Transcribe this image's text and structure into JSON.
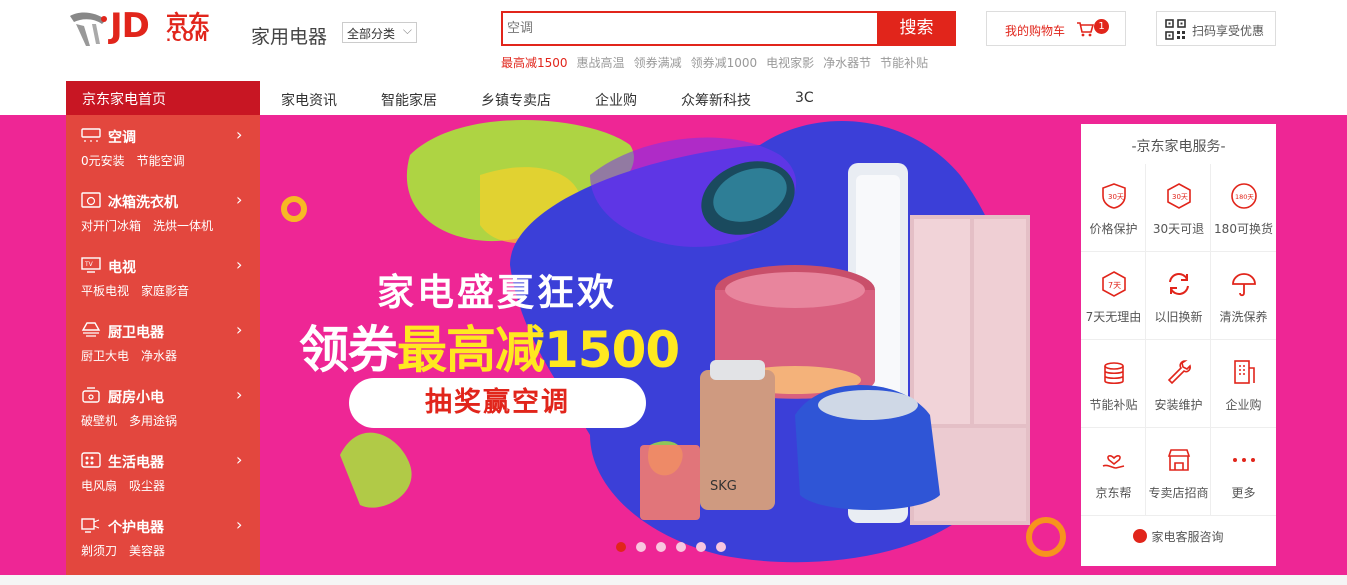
{
  "header": {
    "logo": {
      "text": "JD",
      "cn": "京东",
      "com": ".COM"
    },
    "site_title": "家用电器",
    "all_categories": "全部分类",
    "search": {
      "placeholder": "空调",
      "button": "搜索"
    },
    "hotwords": [
      "最高减1500",
      "惠战高温",
      "领券满减",
      "领券减1000",
      "电视家影",
      "净水器节",
      "节能补贴"
    ],
    "cart": {
      "label": "我的购物车",
      "count": "1"
    },
    "qr": {
      "label": "扫码享受优惠"
    }
  },
  "nav": {
    "home": "京东家电首页",
    "items": [
      "家电资讯",
      "智能家居",
      "乡镇专卖店",
      "企业购",
      "众筹新科技",
      "3C"
    ]
  },
  "sidebar": {
    "categories": [
      {
        "title": "空调",
        "subs": [
          "0元安装",
          "节能空调"
        ],
        "icon": "air-conditioner-icon"
      },
      {
        "title": "冰箱洗衣机",
        "subs": [
          "对开门冰箱",
          "洗烘一体机"
        ],
        "icon": "washer-icon"
      },
      {
        "title": "电视",
        "subs": [
          "平板电视",
          "家庭影音"
        ],
        "icon": "tv-icon"
      },
      {
        "title": "厨卫电器",
        "subs": [
          "厨卫大电",
          "净水器"
        ],
        "icon": "range-hood-icon"
      },
      {
        "title": "厨房小电",
        "subs": [
          "破壁机",
          "多用途锅"
        ],
        "icon": "cooker-icon"
      },
      {
        "title": "生活电器",
        "subs": [
          "电风扇",
          "吸尘器"
        ],
        "icon": "appliance-icon"
      },
      {
        "title": "个护电器",
        "subs": [
          "剃须刀",
          "美容器"
        ],
        "icon": "shaver-icon"
      }
    ]
  },
  "banner": {
    "headline1": "家电盛夏狂欢",
    "headline2_white": "领券",
    "headline2_yellow": "最高减1500",
    "cta": "抽奖赢空调",
    "slide_count": 6,
    "active_slide": 1,
    "colors": {
      "background": "#ee2695",
      "accent": "#ffe820",
      "brand": "#e1251b"
    }
  },
  "service": {
    "title": "-京东家电服务-",
    "items": [
      {
        "label": "价格保护",
        "icon": "30-days-shield-icon",
        "badge": "30天"
      },
      {
        "label": "30天可退",
        "icon": "30-days-return-icon",
        "badge": "30天"
      },
      {
        "label": "180可换货",
        "icon": "180-days-exchange-icon",
        "badge": "180天"
      },
      {
        "label": "7天无理由",
        "icon": "7-days-icon",
        "badge": "7天"
      },
      {
        "label": "以旧换新",
        "icon": "refresh-icon",
        "badge": ""
      },
      {
        "label": "清洗保养",
        "icon": "umbrella-icon",
        "badge": ""
      },
      {
        "label": "节能补贴",
        "icon": "coin-stack-icon",
        "badge": ""
      },
      {
        "label": "安装维护",
        "icon": "wrench-icon",
        "badge": ""
      },
      {
        "label": "企业购",
        "icon": "building-icon",
        "badge": ""
      },
      {
        "label": "京东帮",
        "icon": "hand-heart-icon",
        "badge": ""
      },
      {
        "label": "专卖店招商",
        "icon": "store-icon",
        "badge": ""
      },
      {
        "label": "更多",
        "icon": "more-dots-icon",
        "badge": ""
      }
    ],
    "consult": "家电客服咨询"
  }
}
